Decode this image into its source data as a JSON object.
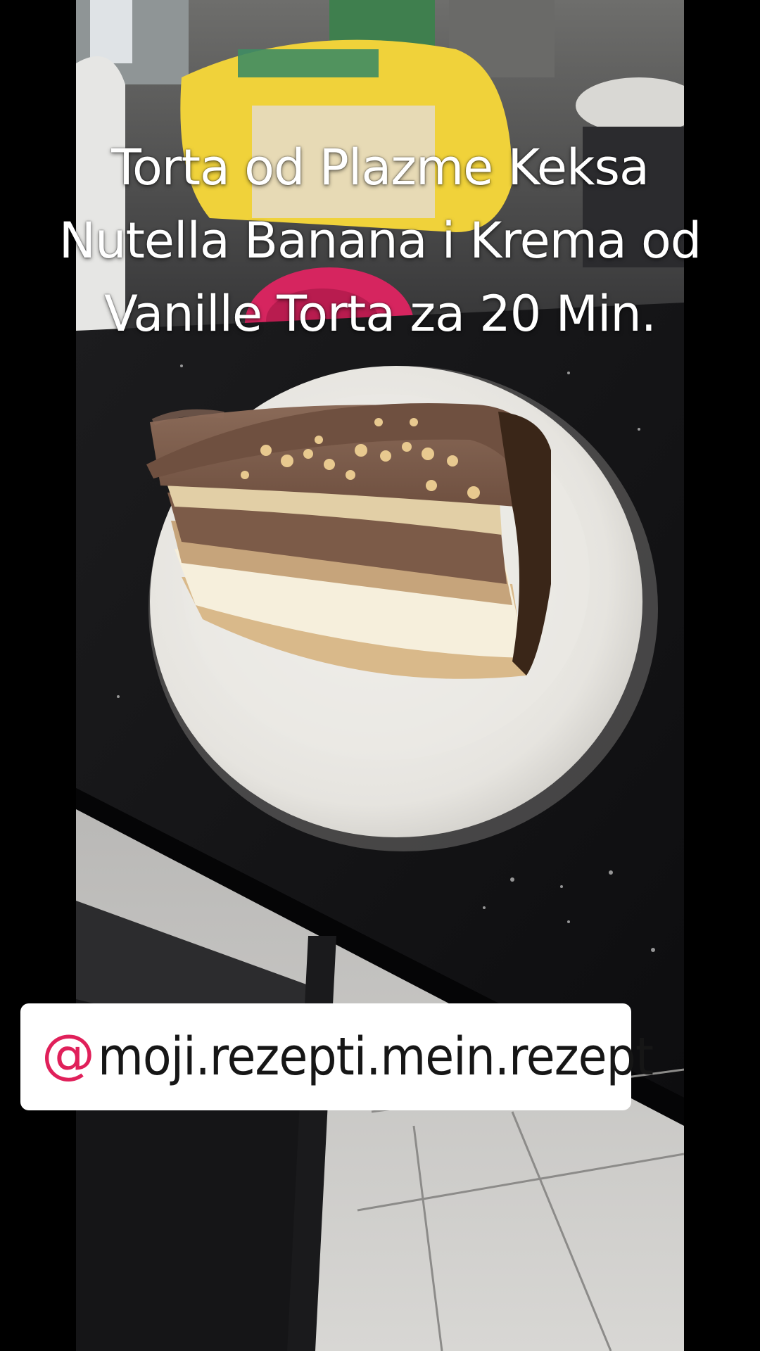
{
  "video": {
    "title": "Torta od Plazme Keksa\nNutella Banana i Krema od\nVanille Torta za 20 Min.",
    "watermark": {
      "icon": "at-sign-icon",
      "at_symbol": "@",
      "handle": "moji.rezepti.mein.rezept",
      "at_color": "#e0205a"
    }
  },
  "photo": {
    "subject": "cake-slice-on-plate"
  }
}
